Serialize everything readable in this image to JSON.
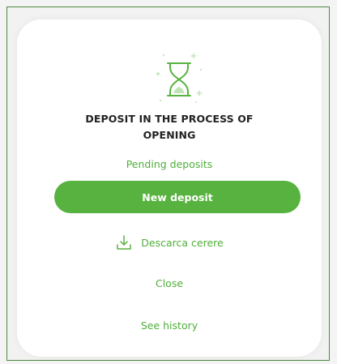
{
  "modal": {
    "title": "DEPOSIT IN THE PROCESS OF\nOPENING",
    "pending_link": "Pending deposits",
    "primary_button": "New deposit",
    "download_link": "Descarca cerere",
    "close_link": "Close",
    "history_link": "See history"
  },
  "icons": {
    "hero": "hourglass-icon",
    "download": "download-icon"
  },
  "colors": {
    "accent": "#58b23f",
    "link": "#4fae3a",
    "title": "#222222",
    "card_bg": "#ffffff",
    "page_bg": "#f3f4f3",
    "frame_border": "#4c8a3e"
  }
}
